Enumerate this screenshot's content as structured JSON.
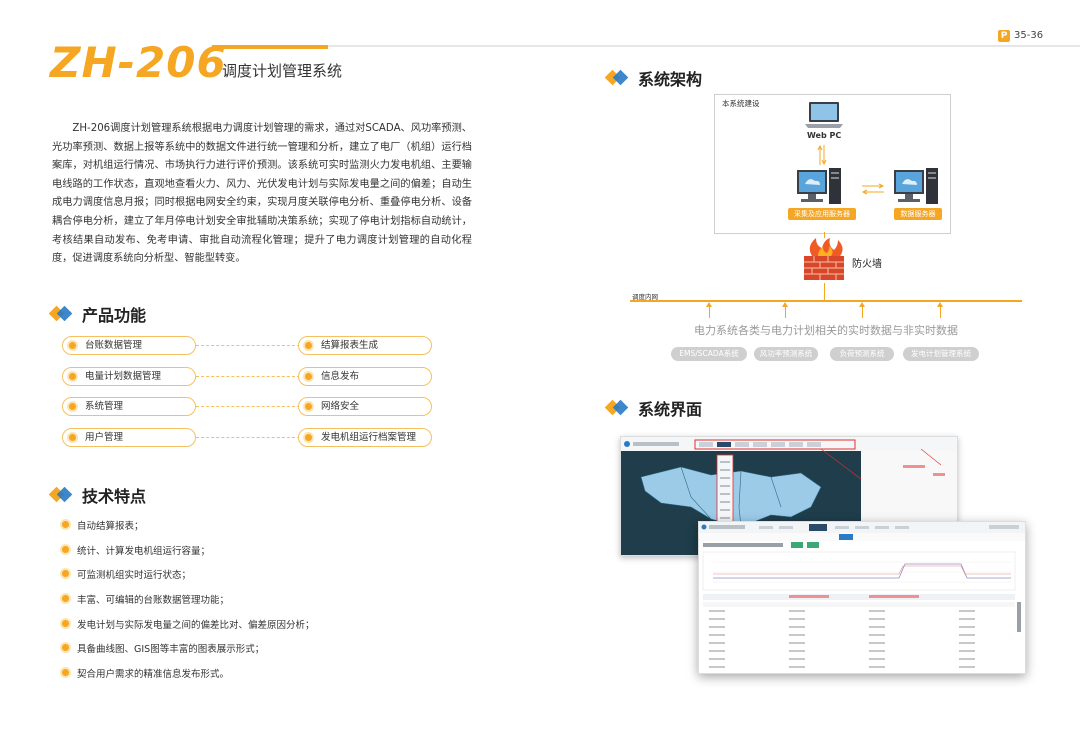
{
  "header": {
    "brand": "ZH-206",
    "subtitle": "调度计划管理系统",
    "page_badge": "P",
    "page_numbers": "35-36"
  },
  "intro": "ZH-206调度计划管理系统根据电力调度计划管理的需求，通过对SCADA、风功率预测、光功率预测、数据上报等系统中的数据文件进行统一管理和分析，建立了电厂（机组）运行档案库，对机组运行情况、市场执行力进行评价预测。该系统可实时监测火力发电机组、主要输电线路的工作状态，直观地查看火力、风力、光伏发电计划与实际发电量之间的偏差；自动生成电力调度信息月报；同时根据电网安全约束，实现月度关联停电分析、重叠停电分析、设备耦合停电分析，建立了年月停电计划安全审批辅助决策系统；实现了停电计划指标自动统计，考核结果自动发布、免考申请、审批自动流程化管理；提升了电力调度计划管理的自动化程度，促进调度系统向分析型、智能型转变。",
  "sections": {
    "functions": "产品功能",
    "features": "技术特点",
    "architecture": "系统架构",
    "interface": "系统界面"
  },
  "functions": {
    "left": [
      "台账数据管理",
      "电量计划数据管理",
      "系统管理",
      "用户管理"
    ],
    "right": [
      "结算报表生成",
      "信息发布",
      "网络安全",
      "发电机组运行档案管理"
    ]
  },
  "features": [
    "自动结算报表；",
    "统计、计算发电机组运行容量；",
    "可监测机组实时运行状态；",
    "丰富、可编辑的台账数据管理功能；",
    "发电计划与实际发电量之间的偏差比对、偏差原因分析；",
    "具备曲线图、GIS图等丰富的图表展示形式；",
    "契合用户需求的精准信息发布形式。"
  ],
  "architecture": {
    "box_label": "本系统建设",
    "webpc": "Web PC",
    "app_server": "采集及应用服务器",
    "data_server": "数据服务器",
    "firewall": "防火墙",
    "network": "调度内网",
    "data_desc": "电力系统各类与电力计划相关的实时数据与非实时数据",
    "sources": [
      "EMS/SCADA系统",
      "风功率预测系统",
      "负荷预测系统",
      "发电计划管理系统"
    ]
  },
  "colors": {
    "accent": "#f5a623",
    "blue": "#2a7ac5",
    "gray": "#cfcfcf"
  }
}
